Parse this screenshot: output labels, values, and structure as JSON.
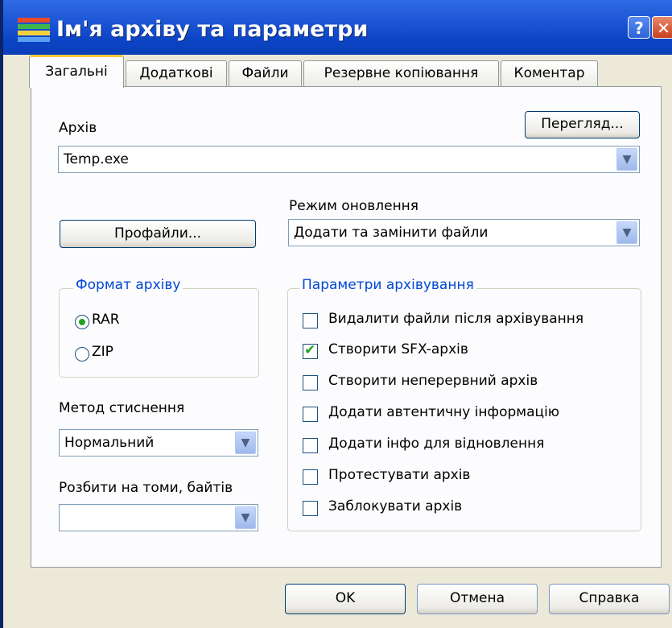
{
  "window": {
    "title": "Ім'я архіву та параметри",
    "help_label": "?",
    "close_label": "✕"
  },
  "tabs": [
    "Загальні",
    "Додаткові",
    "Файли",
    "Резервне копіювання",
    "Коментар"
  ],
  "archive": {
    "label": "Архів",
    "value": "Temp.exe",
    "browse_label": "Перегляд..."
  },
  "profiles_label": "Профайли...",
  "update_mode": {
    "label": "Режим оновлення",
    "value": "Додати та замінити файли"
  },
  "format": {
    "title": "Формат архіву",
    "options": [
      "RAR",
      "ZIP"
    ],
    "selected": "RAR"
  },
  "compression": {
    "label": "Метод стиснення",
    "value": "Нормальний"
  },
  "split": {
    "label": "Розбити на томи, байтів",
    "value": ""
  },
  "options": {
    "title": "Параметри архівування",
    "items": [
      {
        "label": "Видалити файли після архівування",
        "checked": false
      },
      {
        "label": "Створити SFX-архів",
        "checked": true
      },
      {
        "label": "Створити неперервний архів",
        "checked": false
      },
      {
        "label": "Додати автентичну інформацію",
        "checked": false
      },
      {
        "label": "Додати інфо для відновлення",
        "checked": false
      },
      {
        "label": "Протестувати архів",
        "checked": false
      },
      {
        "label": "Заблокувати архів",
        "checked": false
      }
    ]
  },
  "footer": {
    "ok_label": "OK",
    "cancel_label": "Отмена",
    "help_label": "Справка"
  },
  "colors": {
    "title_blue": "#0A3FB7",
    "group_title": "#0046D5",
    "check_green": "#21A121",
    "tab_highlight": "#FFC83C"
  }
}
